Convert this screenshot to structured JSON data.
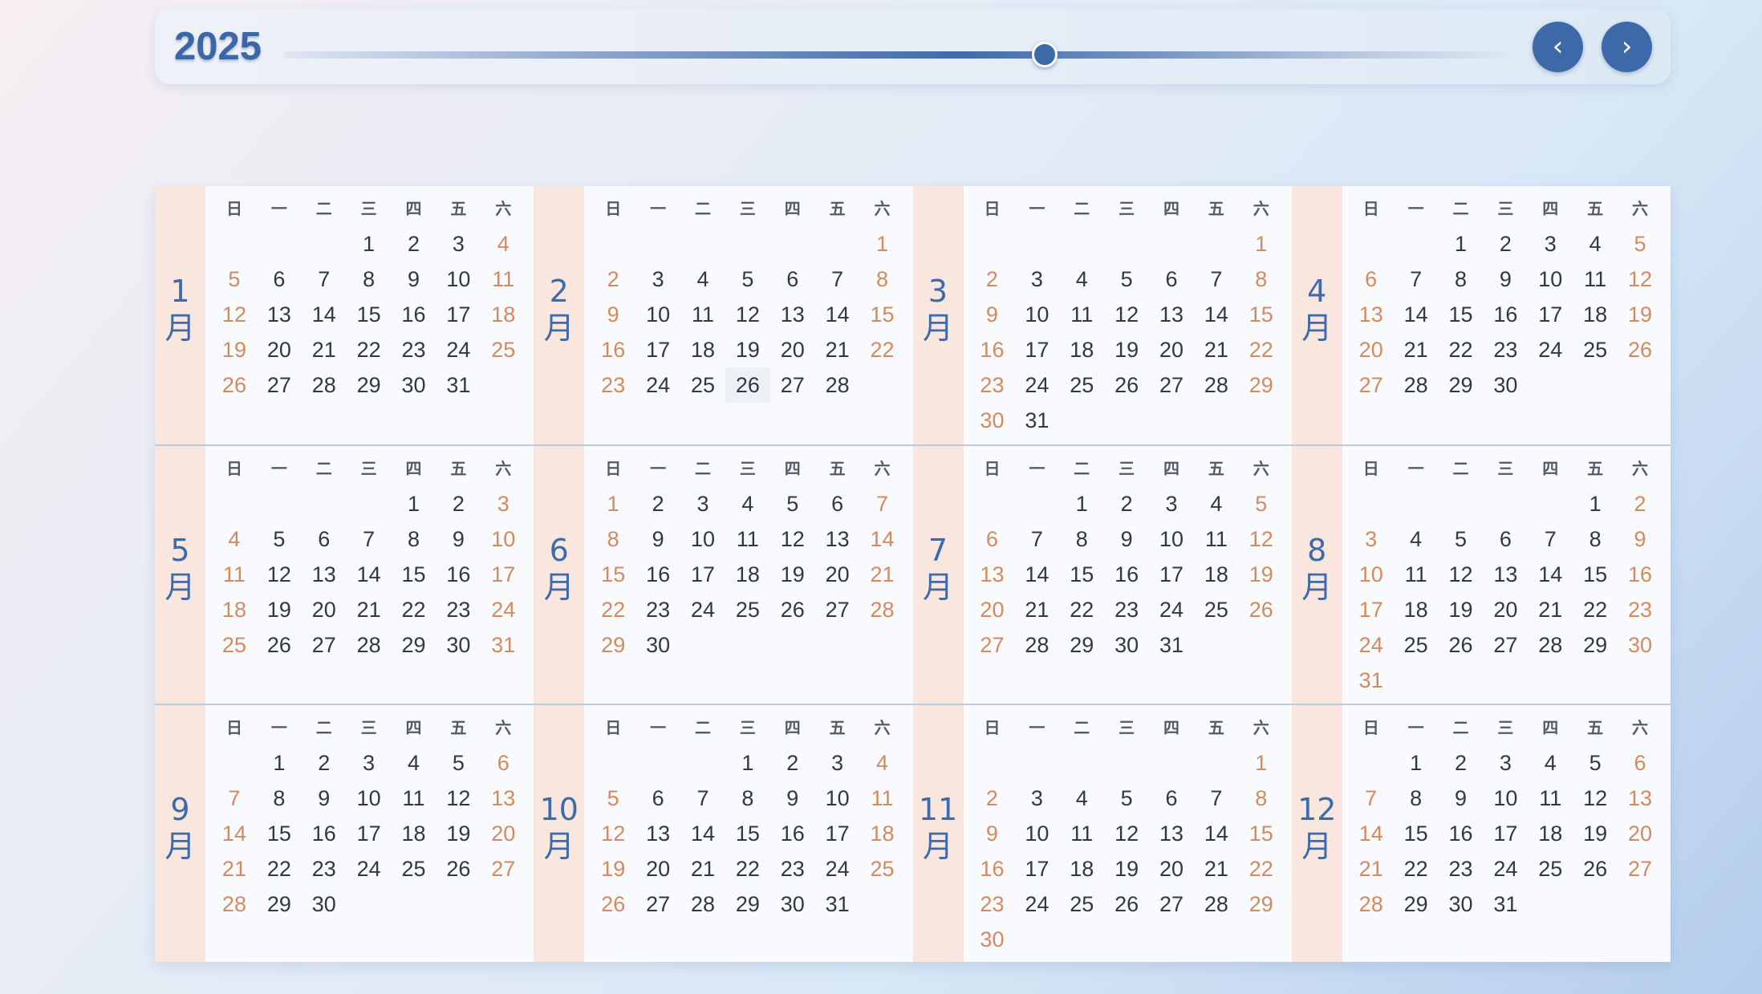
{
  "year": {
    "label": "2025",
    "slider_fraction": 0.62,
    "prev_label": "‹",
    "next_label": "›"
  },
  "weekday_labels": [
    "日",
    "一",
    "二",
    "三",
    "四",
    "五",
    "六"
  ],
  "month_suffix": "月",
  "today": {
    "month": 2,
    "day": 26
  },
  "months": [
    {
      "number": "1",
      "start": 3,
      "days": 31
    },
    {
      "number": "2",
      "start": 6,
      "days": 28
    },
    {
      "number": "3",
      "start": 6,
      "days": 31
    },
    {
      "number": "4",
      "start": 2,
      "days": 30
    },
    {
      "number": "5",
      "start": 4,
      "days": 31
    },
    {
      "number": "6",
      "start": 0,
      "days": 30
    },
    {
      "number": "7",
      "start": 2,
      "days": 31
    },
    {
      "number": "8",
      "start": 5,
      "days": 31
    },
    {
      "number": "9",
      "start": 1,
      "days": 30
    },
    {
      "number": "10",
      "start": 3,
      "days": 31
    },
    {
      "number": "11",
      "start": 6,
      "days": 30
    },
    {
      "number": "12",
      "start": 1,
      "days": 31
    }
  ],
  "colors": {
    "accent": "#3d69a8",
    "weekend": "#d4895f",
    "month_label_bg": "#f9e6df"
  }
}
